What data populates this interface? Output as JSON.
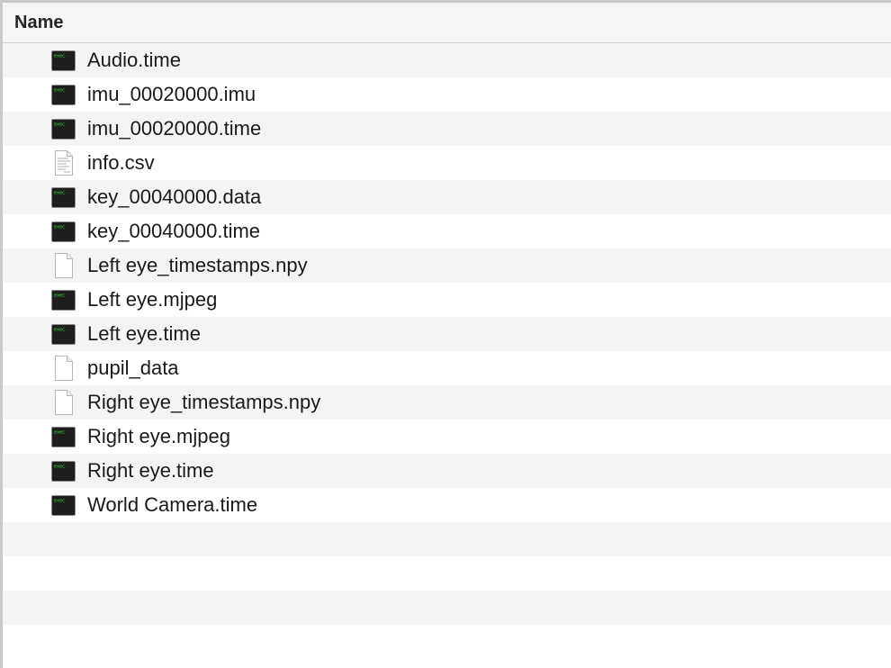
{
  "header": {
    "name_column_label": "Name"
  },
  "files": [
    {
      "name": "Audio.time",
      "icon": "exec-icon"
    },
    {
      "name": "imu_00020000.imu",
      "icon": "exec-icon"
    },
    {
      "name": "imu_00020000.time",
      "icon": "exec-icon"
    },
    {
      "name": "info.csv",
      "icon": "spreadsheet-doc-icon"
    },
    {
      "name": "key_00040000.data",
      "icon": "exec-icon"
    },
    {
      "name": "key_00040000.time",
      "icon": "exec-icon"
    },
    {
      "name": "Left eye_timestamps.npy",
      "icon": "blank-doc-icon"
    },
    {
      "name": "Left eye.mjpeg",
      "icon": "exec-icon"
    },
    {
      "name": "Left eye.time",
      "icon": "exec-icon"
    },
    {
      "name": "pupil_data",
      "icon": "blank-doc-icon"
    },
    {
      "name": "Right eye_timestamps.npy",
      "icon": "blank-doc-icon"
    },
    {
      "name": "Right eye.mjpeg",
      "icon": "exec-icon"
    },
    {
      "name": "Right eye.time",
      "icon": "exec-icon"
    },
    {
      "name": "World Camera.time",
      "icon": "exec-icon"
    }
  ],
  "empty_rows": 4,
  "exec_icon_text": "exec",
  "colors": {
    "row_alt": "#f4f4f4",
    "row_plain": "#ffffff",
    "exec_icon_bg": "#1e1e1e",
    "exec_icon_text": "#3fdc3f"
  }
}
